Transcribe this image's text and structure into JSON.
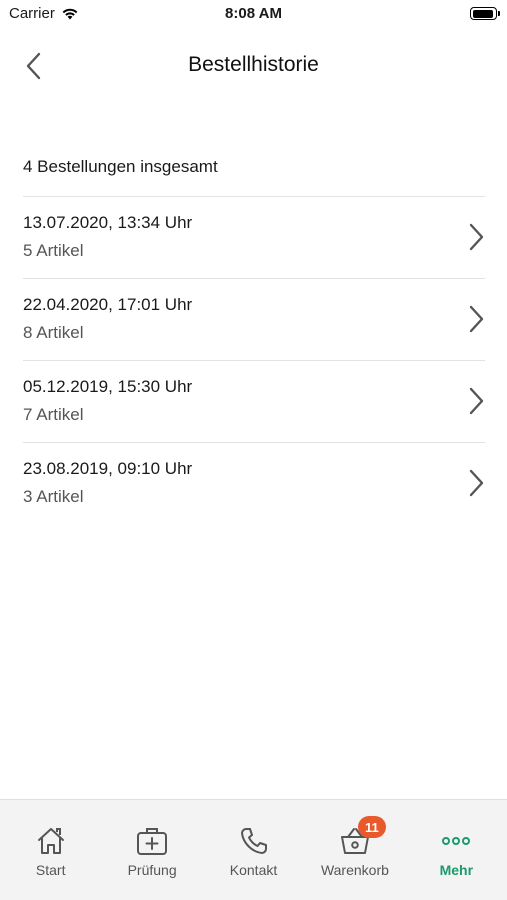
{
  "status_bar": {
    "carrier": "Carrier",
    "time": "8:08 AM"
  },
  "nav": {
    "title": "Bestellhistorie"
  },
  "summary": "4 Bestellungen insgesamt",
  "orders": [
    {
      "date": "13.07.2020, 13:34 Uhr",
      "count": "5 Artikel"
    },
    {
      "date": "22.04.2020, 17:01 Uhr",
      "count": "8 Artikel"
    },
    {
      "date": "05.12.2019, 15:30 Uhr",
      "count": "7 Artikel"
    },
    {
      "date": "23.08.2019, 09:10 Uhr",
      "count": "3 Artikel"
    }
  ],
  "tabs": [
    {
      "label": "Start",
      "icon": "home-icon"
    },
    {
      "label": "Prüfung",
      "icon": "first-aid-kit-icon"
    },
    {
      "label": "Kontakt",
      "icon": "phone-icon"
    },
    {
      "label": "Warenkorb",
      "icon": "basket-icon",
      "badge": "11"
    },
    {
      "label": "Mehr",
      "icon": "more-dots-icon",
      "active": true
    }
  ],
  "colors": {
    "accent": "#1c9a6c",
    "badge": "#e85a2c",
    "icon": "#555555"
  }
}
